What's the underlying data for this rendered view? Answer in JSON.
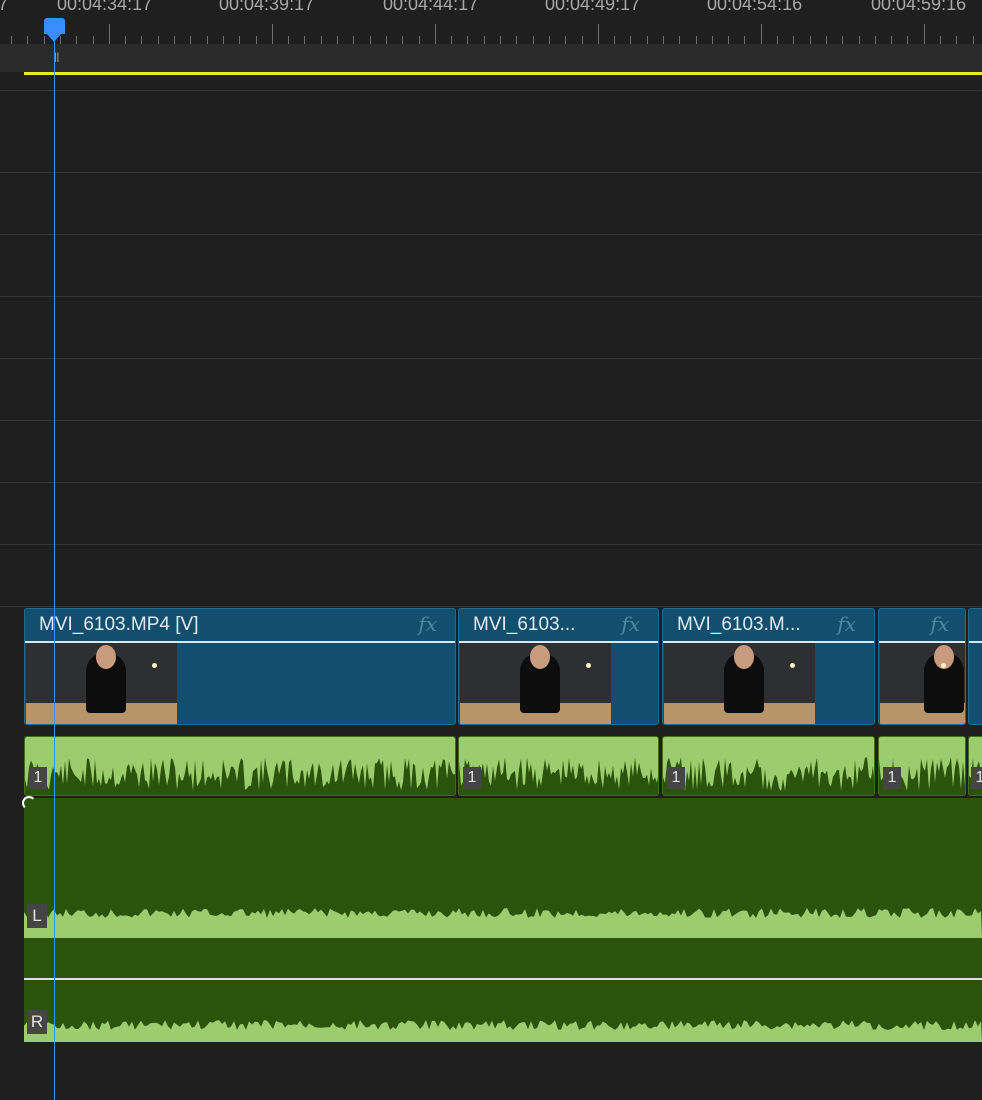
{
  "ruler": {
    "timecodes": [
      "00:04:34:17",
      "00:04:39:17",
      "00:04:44:17",
      "00:04:49:17",
      "00:04:54:16",
      "00:04:59:16"
    ],
    "left_edge_fragment": "7"
  },
  "colors": {
    "playhead": "#3a8cff",
    "work_area": "#ecec18",
    "video_clip": "#124f6f",
    "audio_clip": "#2c530b",
    "waveform": "#9bcc6d"
  },
  "video_track": {
    "clips": [
      {
        "name": "MVI_6103.MP4 [V]",
        "fx": "fx"
      },
      {
        "name": "MVI_6103...",
        "fx": "fx"
      },
      {
        "name": "MVI_6103.M...",
        "fx": "fx"
      },
      {
        "name": "",
        "fx": "fx"
      },
      {
        "name": "",
        "fx": ""
      }
    ]
  },
  "audio_track": {
    "clips": [
      {
        "channel": "1"
      },
      {
        "channel": "1"
      },
      {
        "channel": "1"
      },
      {
        "channel": "1"
      },
      {
        "channel": "1"
      }
    ]
  },
  "master_track": {
    "left_label": "L",
    "right_label": "R"
  },
  "icons": [
    "playhead-icon",
    "fx-badge-icon",
    "keyframe-icon"
  ]
}
